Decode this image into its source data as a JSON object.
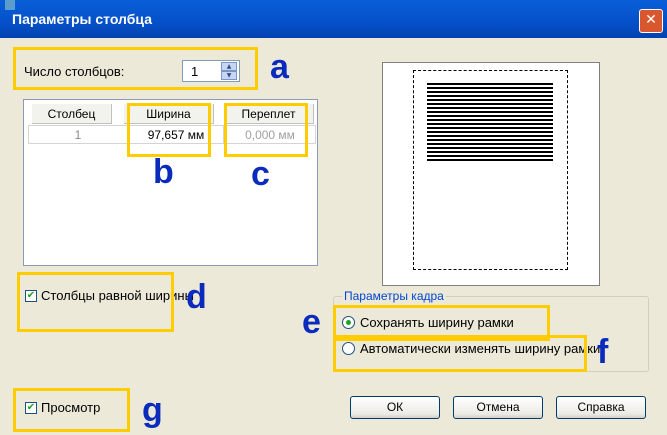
{
  "window": {
    "title": "Параметры столбца",
    "close_glyph": "✕"
  },
  "columns_count": {
    "label": "Число столбцов:",
    "value": "1"
  },
  "table": {
    "headers": [
      "Столбец",
      "Ширина",
      "Переплет"
    ],
    "rows": [
      {
        "column": "1",
        "width": "97,657 мм",
        "gutter": "0,000 мм"
      }
    ]
  },
  "equal_width_checkbox": {
    "label": "Столбцы равной ширины",
    "checked": true
  },
  "frame_group": {
    "legend": "Параметры кадра",
    "options": [
      {
        "label": "Сохранять ширину рамки",
        "selected": true
      },
      {
        "label": "Автоматически изменять ширину рамки",
        "selected": false
      }
    ]
  },
  "preview_checkbox": {
    "label": "Просмотр",
    "checked": true
  },
  "buttons": {
    "ok": "ОК",
    "cancel": "Отмена",
    "help": "Справка"
  },
  "annotations": {
    "a": "a",
    "b": "b",
    "c": "c",
    "d": "d",
    "e": "e",
    "f": "f",
    "g": "g"
  },
  "colors": {
    "highlight": "#ffcc00",
    "annotation_text": "#0b2bbd",
    "title_bar": "#0a5fd8"
  }
}
